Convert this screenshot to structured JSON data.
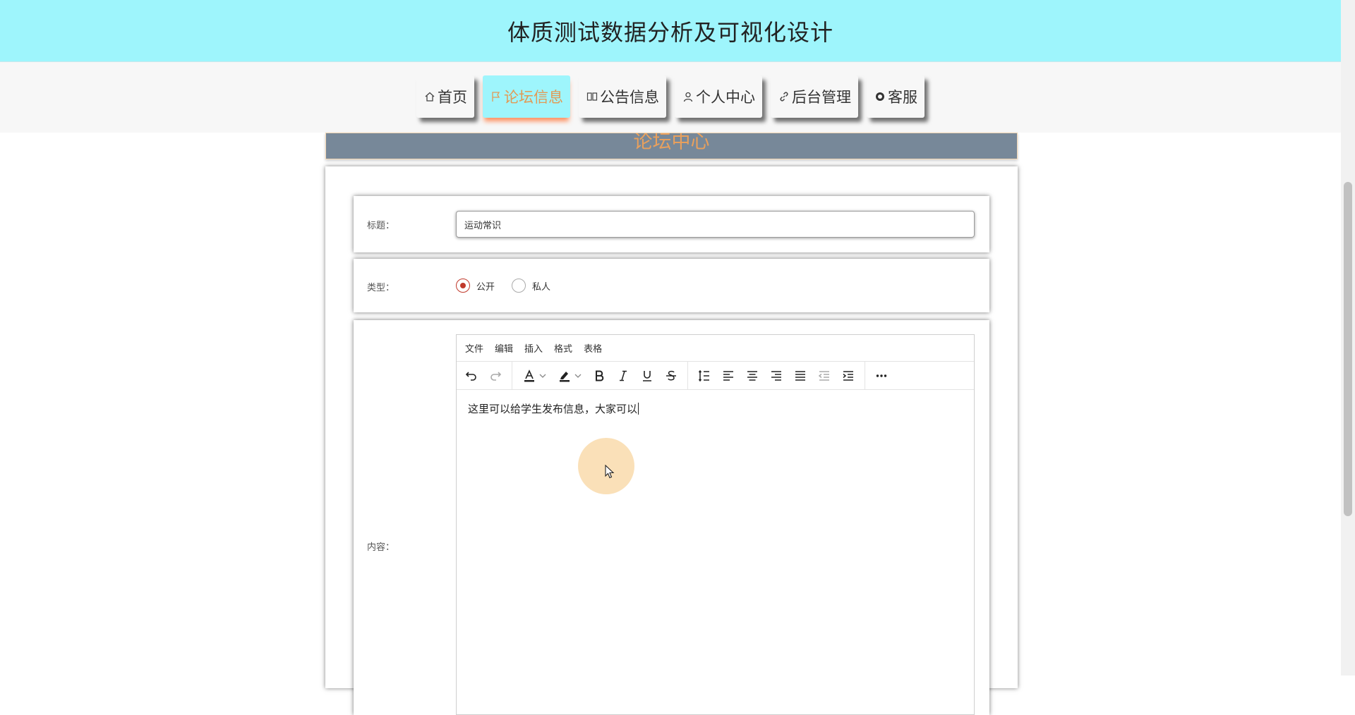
{
  "header": {
    "title": "体质测试数据分析及可视化设计"
  },
  "nav": {
    "items": [
      {
        "label": "首页",
        "icon": "home-icon"
      },
      {
        "label": "论坛信息",
        "icon": "flag-icon",
        "active": true
      },
      {
        "label": "公告信息",
        "icon": "book-icon"
      },
      {
        "label": "个人中心",
        "icon": "user-icon"
      },
      {
        "label": "后台管理",
        "icon": "link-icon"
      },
      {
        "label": "客服",
        "icon": "chat-icon"
      }
    ]
  },
  "banner": {
    "title": "论坛中心"
  },
  "form": {
    "title_label": "标题：",
    "title_value": "运动常识",
    "type_label": "类型：",
    "type_options": [
      {
        "label": "公开",
        "checked": true
      },
      {
        "label": "私人",
        "checked": false
      }
    ],
    "content_label": "内容："
  },
  "editor": {
    "menu": [
      "文件",
      "编辑",
      "插入",
      "格式",
      "表格"
    ],
    "toolbar_icons": [
      "undo-icon",
      "redo-icon",
      "text-color-icon",
      "highlight-icon",
      "bold-icon",
      "italic-icon",
      "underline-icon",
      "strikethrough-icon",
      "line-height-icon",
      "align-left-icon",
      "align-center-icon",
      "align-right-icon",
      "align-justify-icon",
      "outdent-icon",
      "indent-icon",
      "more-icon"
    ],
    "content": "这里可以给学生发布信息，大家可以"
  },
  "colors": {
    "header_bg": "#9ef5fc",
    "active_nav_text": "#e29a55",
    "banner_bg": "#778899",
    "banner_text": "#e8a05d",
    "radio_checked": "#c0392b"
  }
}
